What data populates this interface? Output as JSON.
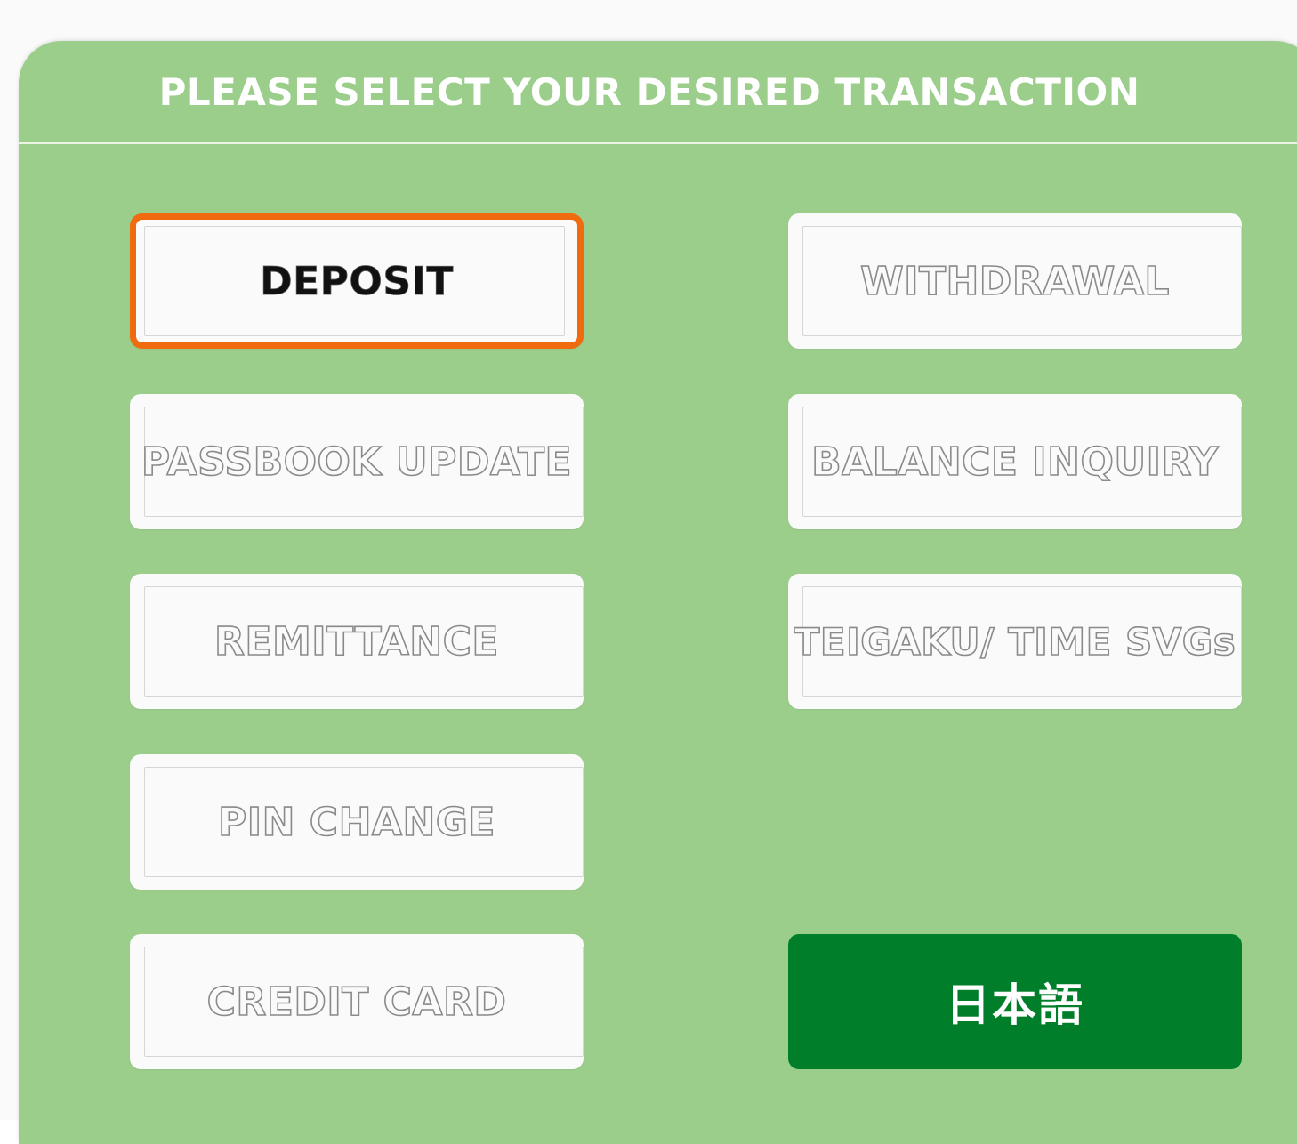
{
  "panel": {
    "title": "PLEASE SELECT YOUR DESIRED TRANSACTION"
  },
  "transactions": {
    "deposit": {
      "label": "DEPOSIT",
      "selected": true
    },
    "withdrawal": {
      "label": "WITHDRAWAL"
    },
    "passbook_update": {
      "label": "PASSBOOK UPDATE"
    },
    "balance_inquiry": {
      "label": "BALANCE INQUIRY"
    },
    "remittance": {
      "label": "REMITTANCE"
    },
    "teigaku": {
      "label": "TEIGAKU/ TIME SVGs"
    },
    "pin_change": {
      "label": "PIN CHANGE"
    },
    "credit_card": {
      "label": "CREDIT CARD"
    }
  },
  "language_button": {
    "label": "日本語"
  },
  "colors": {
    "panel_background": "#9bce8b",
    "button_background": "#fafafa",
    "selected_border": "#f06a10",
    "language_button_background": "#007e2a"
  }
}
